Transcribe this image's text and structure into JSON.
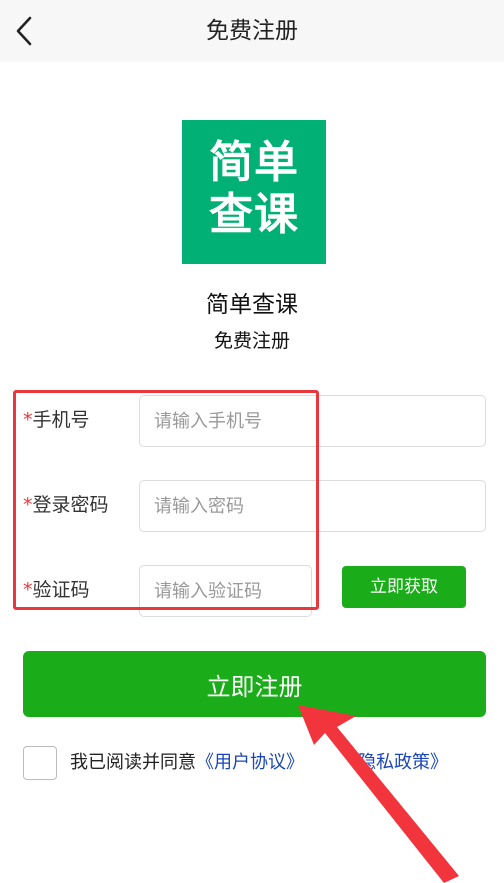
{
  "header": {
    "title": "免费注册"
  },
  "logo": {
    "line1": "简单",
    "line2": "查课",
    "color": "#00b075"
  },
  "app": {
    "name": "简单查课",
    "subtitle": "免费注册"
  },
  "form": {
    "required_mark": "*",
    "phone": {
      "label": "手机号",
      "placeholder": "请输入手机号",
      "value": ""
    },
    "password": {
      "label": "登录密码",
      "placeholder": "请输入密码",
      "value": ""
    },
    "code": {
      "label": "验证码",
      "placeholder": "请输入验证码",
      "value": ""
    },
    "get_code_label": "立即获取",
    "register_label": "立即注册"
  },
  "agreement": {
    "text": "我已阅读并同意",
    "user_agreement": "《用户协议》",
    "privacy_policy": "《隐私政策》",
    "checked": false
  },
  "colors": {
    "primary_button": "#1aad19",
    "highlight": "#e8383d",
    "link": "#1a46b8"
  }
}
